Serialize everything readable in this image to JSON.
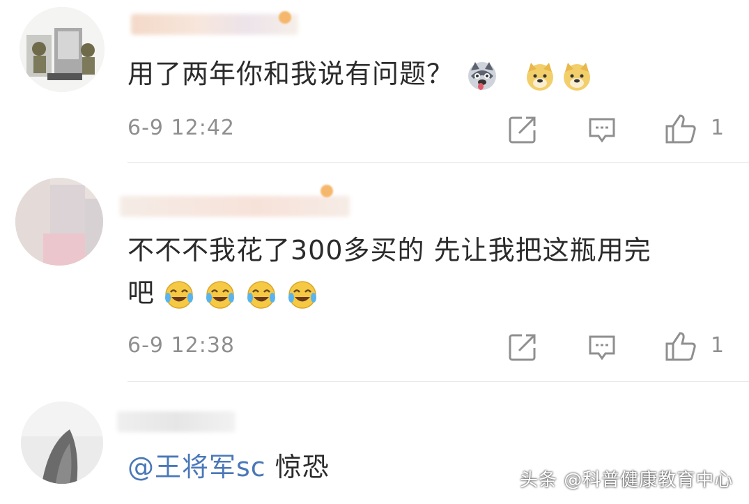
{
  "comments": [
    {
      "text": "用了两年你和我说有问题？",
      "emoji": [
        "husky-emoji",
        "doge-emoji",
        "doge-emoji"
      ],
      "time": "6-9 12:42",
      "likes": "1"
    },
    {
      "text_line1": "不不不我花了300多买的 先让我把这瓶用完",
      "text_line2": "吧",
      "emoji": [
        "laugh-cry-emoji",
        "laugh-cry-emoji",
        "laugh-cry-emoji",
        "laugh-cry-emoji"
      ],
      "time": "6-9 12:38",
      "likes": "1"
    },
    {
      "mention": "@王将军sc",
      "text": " 惊恐"
    }
  ],
  "watermark": "头条 @科普健康教育中心",
  "icons": {
    "share": "share-icon",
    "reply": "comment-icon",
    "like": "thumbs-up-icon"
  },
  "colors": {
    "time": "#8f8f8f",
    "mention": "#4a78b8",
    "divider": "#e6e6e6"
  }
}
